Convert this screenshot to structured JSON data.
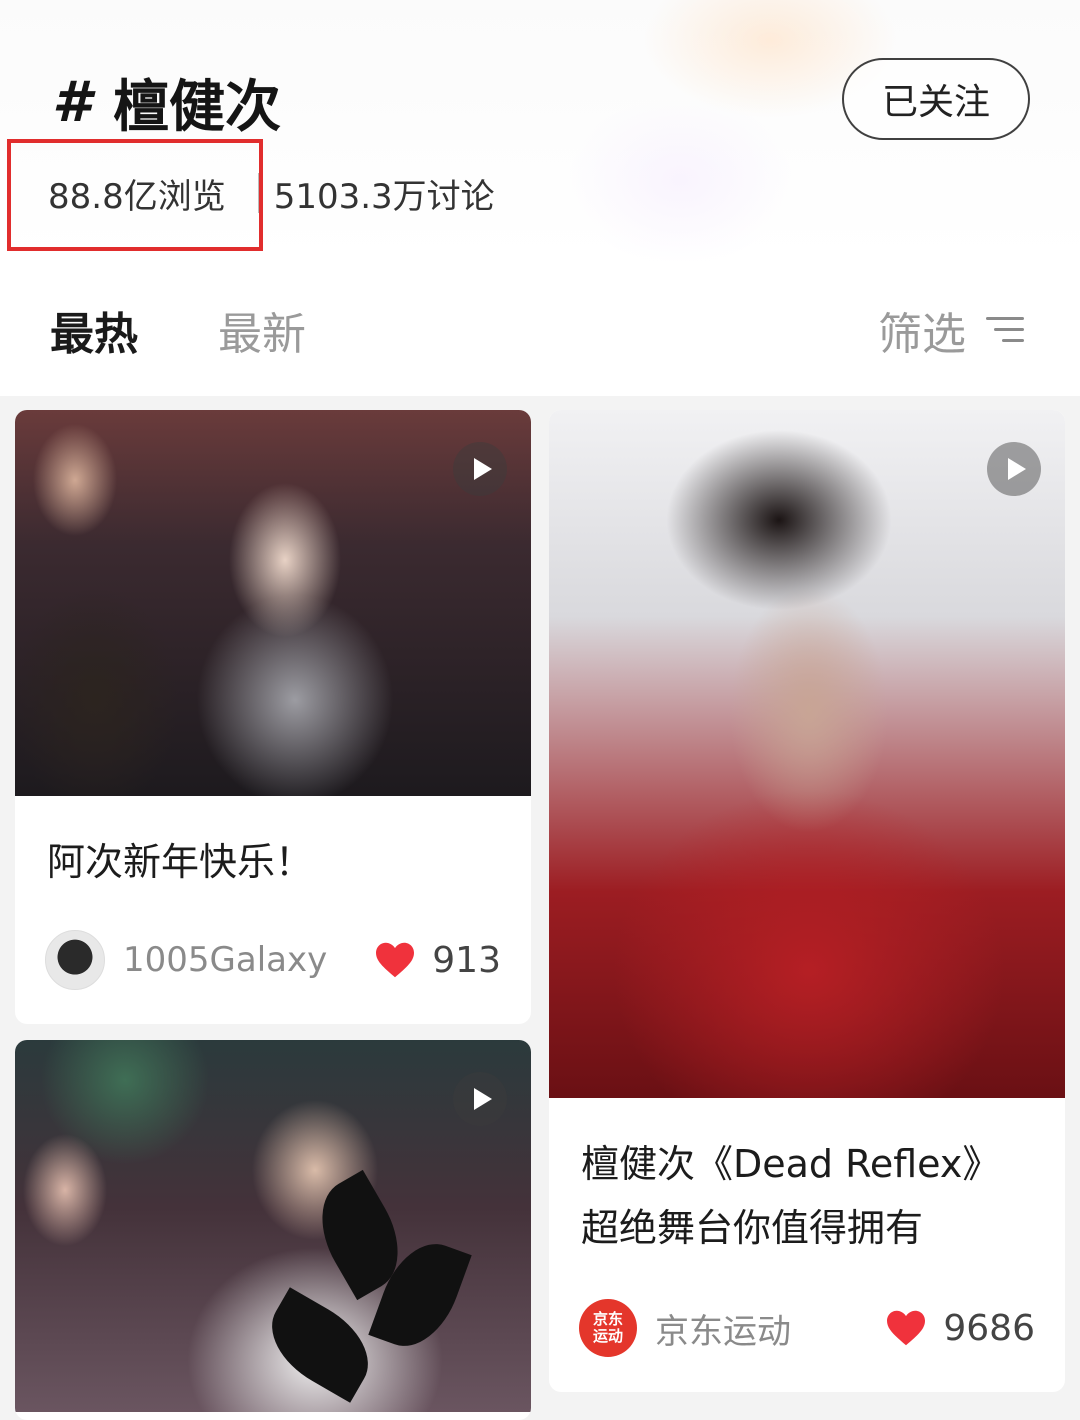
{
  "topic": {
    "hash": "#",
    "name": "檀健次"
  },
  "follow_button": "已关注",
  "stats": {
    "views": "88.8亿浏览",
    "discussions": "5103.3万讨论"
  },
  "tabs": {
    "hot": "最热",
    "new": "最新"
  },
  "filter_label": "筛选",
  "cards": [
    {
      "title": "阿次新年快乐！",
      "author": "1005Galaxy",
      "likes": "913"
    },
    {
      "title_line1": "檀健次《Dead Reflex》",
      "title_line2": "超绝舞台你值得拥有",
      "author": "京东运动",
      "likes": "9686",
      "avatar_text": "京东运动"
    },
    {}
  ],
  "colors": {
    "highlight_box": "#e12d2d",
    "heart": "#f0323c",
    "jd_avatar": "#e4362b"
  }
}
